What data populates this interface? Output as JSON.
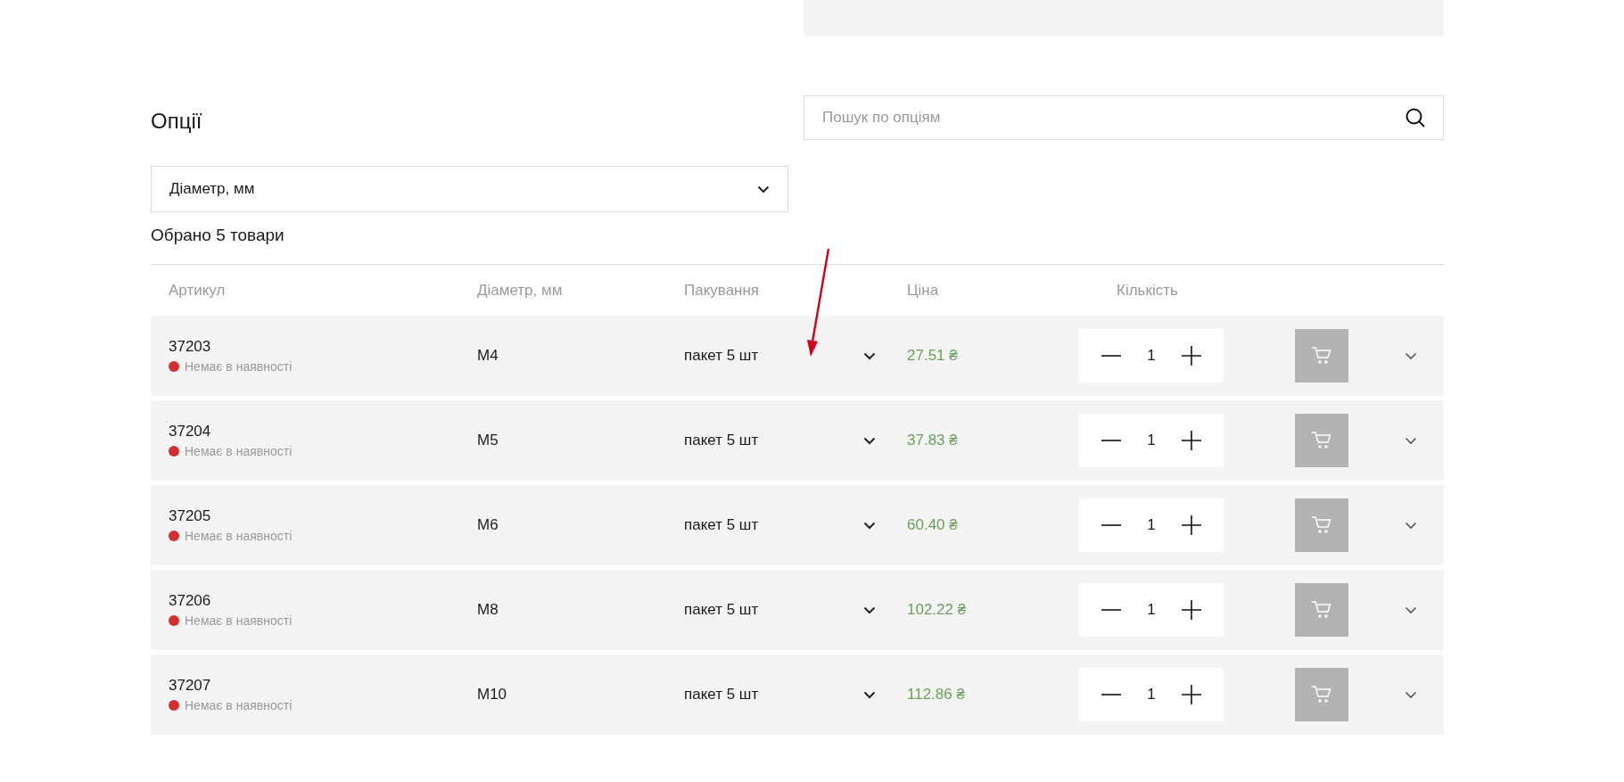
{
  "title": "Опції",
  "search": {
    "placeholder": "Пошук по опціям"
  },
  "filter": {
    "value": "Діаметр, мм"
  },
  "summary": "Обрано 5 товари",
  "columns": [
    "Артикул",
    "Діаметр, мм",
    "Пакування",
    "Ціна",
    "Кількість"
  ],
  "rows": [
    {
      "sku": "37203",
      "status": "Немає в наявності",
      "available": false,
      "diameter": "M4",
      "packaging": "пакет 5 шт",
      "price": "27.51 ₴",
      "quantity": "1"
    },
    {
      "sku": "37204",
      "status": "Немає в наявності",
      "available": false,
      "diameter": "M5",
      "packaging": "пакет 5 шт",
      "price": "37.83 ₴",
      "quantity": "1"
    },
    {
      "sku": "37205",
      "status": "Немає в наявності",
      "available": false,
      "diameter": "M6",
      "packaging": "пакет 5 шт",
      "price": "60.40 ₴",
      "quantity": "1"
    },
    {
      "sku": "37206",
      "status": "Немає в наявності",
      "available": false,
      "diameter": "M8",
      "packaging": "пакет 5 шт",
      "price": "102.22 ₴",
      "quantity": "1"
    },
    {
      "sku": "37207",
      "status": "Немає в наявності",
      "available": false,
      "diameter": "M10",
      "packaging": "пакет 5 шт",
      "price": "112.86 ₴",
      "quantity": "1"
    }
  ]
}
